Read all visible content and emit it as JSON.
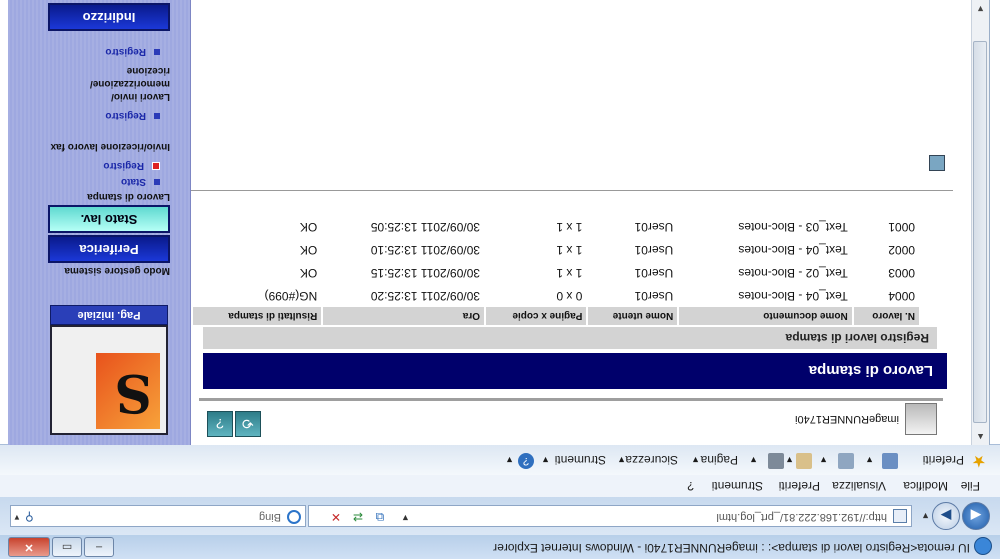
{
  "window": {
    "title": "IU remota<Registro lavori di stampa>: : imageRUNNER1740i - Windows Internet Explorer"
  },
  "address_bar": {
    "url": "http://192.168.222.81/_prt_log.html",
    "search_placeholder": "Bing"
  },
  "menu": [
    "File",
    "Modifica",
    "Visualizza",
    "Preferiti",
    "Strumenti",
    "?"
  ],
  "command_bar": {
    "favorites": "Preferiti",
    "page": "Pagina",
    "security": "Sicurezza",
    "tools": "Strumenti"
  },
  "device": {
    "name": "imageRUNNER1740i"
  },
  "page": {
    "heading": "Lavoro di stampa",
    "section": "Registro lavori di stampa"
  },
  "table": {
    "headers": [
      "N. lavoro",
      "Nome documento",
      "Nome utente",
      "Pagine x copie",
      "Ora",
      "Risultati di stampa"
    ],
    "rows": [
      [
        "0004",
        "Text_04 - Bloc-notes",
        "User01",
        "0 x 0",
        "30/09/2011 13:25:20",
        "NG(#099)"
      ],
      [
        "0003",
        "Text_02 - Bloc-notes",
        "User01",
        "1 x 1",
        "30/09/2011 13:25:15",
        "OK"
      ],
      [
        "0002",
        "Text_04 - Bloc-notes",
        "User01",
        "1 x 1",
        "30/09/2011 13:25:10",
        "OK"
      ],
      [
        "0001",
        "Text_03 - Bloc-notes",
        "User01",
        "1 x 1",
        "30/09/2011 13:25:05",
        "OK"
      ]
    ]
  },
  "nav": {
    "home": "Pag. iniziale",
    "mode_label": "Modo gestore sistema",
    "periferica": "Periferica",
    "stato_lav": "Stato lav.",
    "group1_label": "Lavoro di stampa",
    "group1_items": [
      "Stato",
      "Registro"
    ],
    "group2_label": "Invio/ricezione lavoro fax",
    "group2_items": [
      "Registro"
    ],
    "group3_label": "Lavori invio/ memorizzazione/ ricezione",
    "group3_items": [
      "Registro"
    ],
    "indirizzo": "Indirizzo"
  }
}
